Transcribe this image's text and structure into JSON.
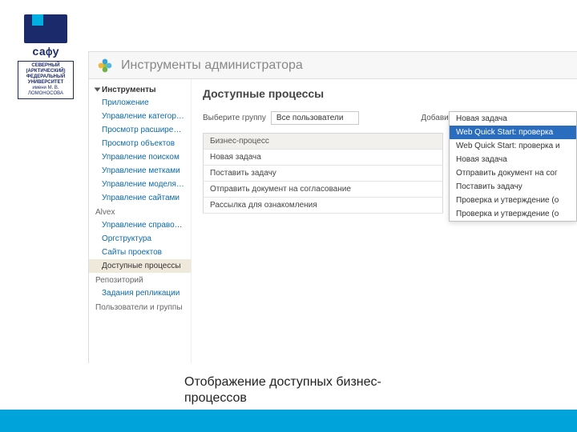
{
  "logo": {
    "word": "cафу",
    "lines": [
      "СЕВЕРНЫЙ",
      "(АРКТИЧЕСКИЙ)",
      "ФЕДЕРАЛЬНЫЙ",
      "УНИВЕРСИТЕТ",
      "имени М. В. ЛОМОНОСОВА"
    ]
  },
  "app": {
    "title": "Инструменты администратора"
  },
  "sidebar": {
    "sections": [
      {
        "label": "Инструменты",
        "strong": true,
        "expanded": true,
        "items": [
          {
            "label": "Приложение"
          },
          {
            "label": "Управление категориями"
          },
          {
            "label": "Просмотр расширений"
          },
          {
            "label": "Просмотр объектов"
          },
          {
            "label": "Управление поиском"
          },
          {
            "label": "Управление метками"
          },
          {
            "label": "Управление моделями"
          },
          {
            "label": "Управление сайтами"
          }
        ]
      },
      {
        "label": "Alvex",
        "strong": false,
        "items": [
          {
            "label": "Управление справочниками"
          },
          {
            "label": "Оргструктура"
          },
          {
            "label": "Сайты проектов"
          },
          {
            "label": "Доступные процессы",
            "active": true
          }
        ]
      },
      {
        "label": "Репозиторий",
        "strong": false,
        "items": [
          {
            "label": "Задания репликации"
          }
        ]
      },
      {
        "label": "Пользователи и группы",
        "strong": false,
        "items": []
      }
    ]
  },
  "main": {
    "title": "Доступные процессы",
    "group_label": "Выберите группу",
    "group_value": "Все пользователи",
    "add_label": "Добавить процесс",
    "add_value": "Новая задача",
    "table": {
      "header": "Бизнес-процесс",
      "rows": [
        "Новая задача",
        "Поставить задачу",
        "Отправить документ на согласование",
        "Рассылка для ознакомления"
      ]
    },
    "dropdown": {
      "items": [
        {
          "label": "Новая задача"
        },
        {
          "label": "Web Quick Start: проверка",
          "selected": true
        },
        {
          "label": "Web Quick Start: проверка и"
        },
        {
          "label": "Новая задача"
        },
        {
          "label": "Отправить документ на сог"
        },
        {
          "label": "Поставить задачу"
        },
        {
          "label": "Проверка и утверждение (о"
        },
        {
          "label": "Проверка и утверждение (о"
        }
      ]
    }
  },
  "caption": "Отображение доступных бизнес-процессов"
}
